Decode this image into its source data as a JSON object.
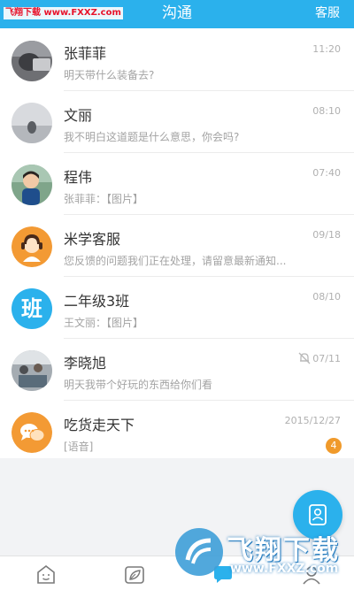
{
  "header": {
    "title": "沟通",
    "service_label": "客服",
    "watermark": "飞翔下载 www.FXXZ.com",
    "background": "#2bb1ec"
  },
  "conversations": [
    {
      "name": "张菲菲",
      "message": "明天带什么装备去?",
      "time": "11:20",
      "avatar": "photo-person-icon"
    },
    {
      "name": "文丽",
      "message": "我不明白这道题是什么意思，你会吗?",
      "time": "08:10",
      "avatar": "photo-landscape-icon"
    },
    {
      "name": "程伟",
      "message": "张菲菲：【图片】",
      "time": "07:40",
      "avatar": "photo-child-icon"
    },
    {
      "name": "米学客服",
      "message": "您反馈的问题我们正在处理，请留意最新通知...",
      "time": "09/18",
      "avatar": "support-agent-icon"
    },
    {
      "name": "二年级3班",
      "message": "王文丽：【图片】",
      "time": "08/10",
      "avatar": "class-group-icon",
      "avatar_text": "班"
    },
    {
      "name": "李晓旭",
      "message": "明天我带个好玩的东西给你们看",
      "time": "07/11",
      "avatar": "photo-group-icon",
      "muted": true
    },
    {
      "name": "吃货走天下",
      "message": "[语音]",
      "time": "2015/12/27",
      "avatar": "chat-group-icon",
      "badge": "4"
    }
  ],
  "fab": {
    "icon": "contacts-icon",
    "color": "#2bb1ec"
  },
  "tabbar": {
    "tabs": [
      {
        "icon": "smiley-icon"
      },
      {
        "icon": "leaf-card-icon"
      },
      {
        "icon": "chat-icon"
      },
      {
        "icon": "profile-icon"
      }
    ]
  },
  "watermark_logo": {
    "main": "飞翔下载",
    "sub": "www.FXXZ.com"
  }
}
